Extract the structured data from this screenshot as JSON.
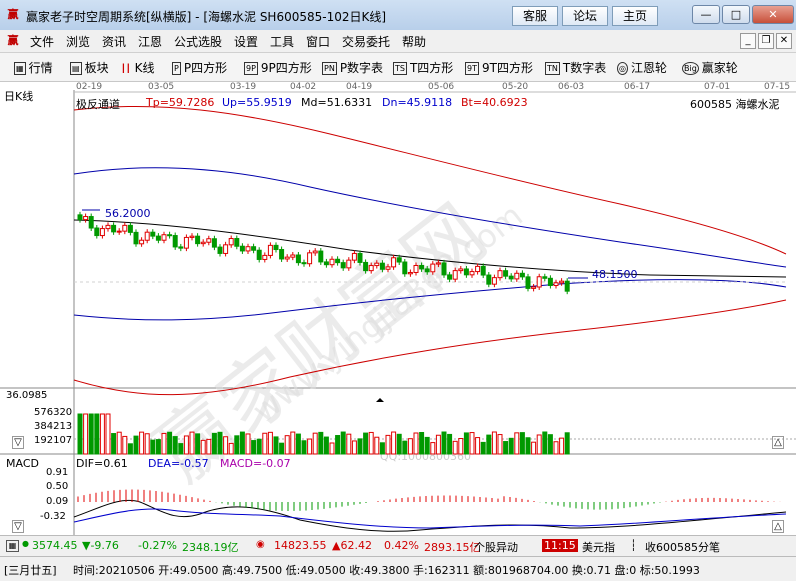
{
  "window": {
    "title": "赢家老子时空周期系统[纵横版] - [海螺水泥  SH600585-102日K线]",
    "links": [
      "客服",
      "论坛",
      "主页"
    ]
  },
  "menu": [
    "文件",
    "浏览",
    "资讯",
    "江恩",
    "公式选股",
    "设置",
    "工具",
    "窗口",
    "交易委托",
    "帮助"
  ],
  "toolbar": [
    {
      "label": "行情",
      "icon": "grid-icon"
    },
    {
      "label": "板块",
      "icon": "blocks-icon"
    },
    {
      "label": "K线",
      "icon": "candle-icon"
    },
    {
      "label": "P四方形",
      "icon": "P"
    },
    {
      "label": "9P四方形",
      "icon": "9P"
    },
    {
      "label": "P数字表",
      "icon": "PN"
    },
    {
      "label": "T四方形",
      "icon": "TS"
    },
    {
      "label": "9T四方形",
      "icon": "9T"
    },
    {
      "label": "T数字表",
      "icon": "TN"
    },
    {
      "label": "江恩轮",
      "icon": "wheel-icon"
    },
    {
      "label": "赢家轮",
      "icon": "Big"
    }
  ],
  "chart": {
    "period_label": "日K线",
    "dates": [
      "02-19",
      "03-05",
      "03-19",
      "04-02",
      "04-19",
      "05-06",
      "05-20",
      "06-03",
      "06-17",
      "07-01",
      "07-15"
    ],
    "indicator": {
      "name": "极反通道",
      "tp": "Tp=59.7286",
      "up": "Up=55.9519",
      "md": "Md=51.6331",
      "dn": "Dn=45.9118",
      "bt": "Bt=40.6923"
    },
    "stock": "600585  海螺水泥",
    "high_marker": "56.2000",
    "low_marker": "48.1500",
    "volume_axis": [
      "36.0985",
      "576320",
      "384213",
      "192107"
    ],
    "macd": {
      "name": "MACD",
      "dif": "DIF=0.61",
      "dea": "DEA=-0.57",
      "macd": "MACD=-0.07",
      "axis": [
        "0.91",
        "0.50",
        "0.09",
        "-0.32"
      ]
    },
    "watermark": "赢家财富网",
    "watermark_url": "www.yingjia360.com",
    "qq": "QQ:1000800360",
    "colors": {
      "up": "#e00000",
      "down": "#009900",
      "channel_outer": "#cc0000",
      "channel_inner": "#0000aa",
      "mid": "#000000"
    },
    "chart_data": {
      "type": "candlestick",
      "title": "",
      "x_dates": [
        "02-19",
        "03-05",
        "03-19",
        "04-02",
        "04-19",
        "05-06",
        "05-20",
        "06-03"
      ],
      "close_approx": [
        55.0,
        53.5,
        52.8,
        51.5,
        50.8,
        50.2,
        49.5,
        48.4
      ],
      "channel": {
        "Tp": 59.7286,
        "Up": 55.9519,
        "Md": 51.6331,
        "Dn": 45.9118,
        "Bt": 40.6923
      },
      "high": 56.2,
      "low": 48.15
    }
  },
  "status": {
    "sh_index": "3574.45",
    "sh_change": "▼-9.76",
    "sh_pct": "-0.27%",
    "sh_amount": "2348.19亿",
    "sz_index": "14823.55",
    "sz_change": "▲62.42",
    "sz_pct": "0.42%",
    "sz_amount": "2893.15亿",
    "alert": "个股异动",
    "time": "11:15",
    "currency": "美元指",
    "close_label": "收600585分笔"
  },
  "quote": {
    "day": "[三月廿五]",
    "text": "时间:20210506 开:49.0500 高:49.7500 低:49.0500 收:49.3800 手:162311 额:801968704.00 换:0.71 盘:0 标:50.1993"
  }
}
